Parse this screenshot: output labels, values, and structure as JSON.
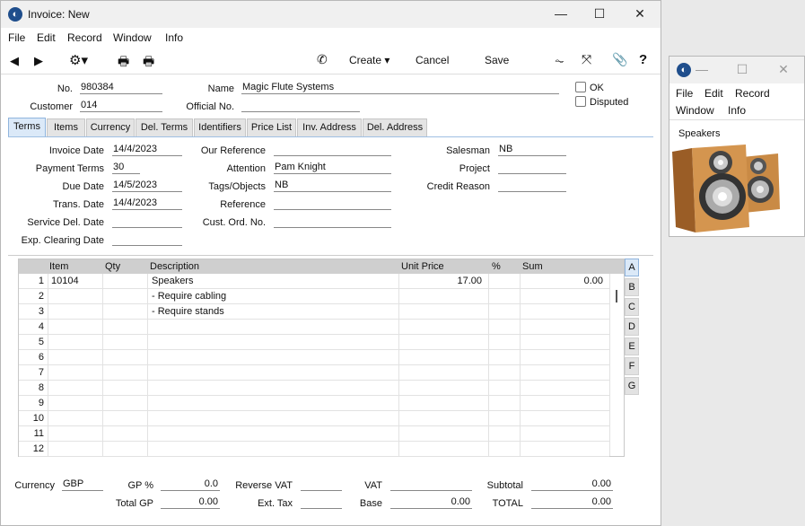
{
  "window": {
    "title": "Invoice: New"
  },
  "menu": [
    "File",
    "Edit",
    "Record",
    "Window",
    "Info"
  ],
  "toolbar": {
    "create": "Create",
    "cancel": "Cancel",
    "save": "Save",
    "help": "?"
  },
  "header": {
    "no_label": "No.",
    "no": "980384",
    "name_label": "Name",
    "name": "Magic Flute Systems",
    "customer_label": "Customer",
    "customer": "014",
    "official_label": "Official No.",
    "official": "",
    "ok_label": "OK",
    "disputed_label": "Disputed"
  },
  "tabs": [
    "Terms",
    "Items",
    "Currency",
    "Del. Terms",
    "Identifiers",
    "Price List",
    "Inv. Address",
    "Del. Address"
  ],
  "terms": {
    "invoice_date_label": "Invoice Date",
    "invoice_date": "14/4/2023",
    "payment_terms_label": "Payment Terms",
    "payment_terms": "30",
    "due_date_label": "Due Date",
    "due_date": "14/5/2023",
    "trans_date_label": "Trans. Date",
    "trans_date": "14/4/2023",
    "service_del_label": "Service Del. Date",
    "service_del": "",
    "exp_clearing_label": "Exp. Clearing Date",
    "exp_clearing": "",
    "our_ref_label": "Our Reference",
    "our_ref": "",
    "attention_label": "Attention",
    "attention": "Pam Knight",
    "tags_label": "Tags/Objects",
    "tags": "NB",
    "reference_label": "Reference",
    "reference": "",
    "cust_ord_label": "Cust. Ord. No.",
    "cust_ord": "",
    "salesman_label": "Salesman",
    "salesman": "NB",
    "project_label": "Project",
    "project": "",
    "credit_reason_label": "Credit Reason",
    "credit_reason": ""
  },
  "grid": {
    "columns": [
      "Item",
      "Qty",
      "Description",
      "Unit Price",
      "%",
      "Sum"
    ],
    "rows": [
      {
        "n": "1",
        "item": "10104",
        "qty": "",
        "desc": "Speakers",
        "price": "17.00",
        "pct": "",
        "sum": "0.00"
      },
      {
        "n": "2",
        "item": "",
        "qty": "",
        "desc": "- Require cabling",
        "price": "",
        "pct": "",
        "sum": ""
      },
      {
        "n": "3",
        "item": "",
        "qty": "",
        "desc": "- Require stands",
        "price": "",
        "pct": "",
        "sum": ""
      },
      {
        "n": "4",
        "item": "",
        "qty": "",
        "desc": "",
        "price": "",
        "pct": "",
        "sum": ""
      },
      {
        "n": "5",
        "item": "",
        "qty": "",
        "desc": "",
        "price": "",
        "pct": "",
        "sum": ""
      },
      {
        "n": "6",
        "item": "",
        "qty": "",
        "desc": "",
        "price": "",
        "pct": "",
        "sum": ""
      },
      {
        "n": "7",
        "item": "",
        "qty": "",
        "desc": "",
        "price": "",
        "pct": "",
        "sum": ""
      },
      {
        "n": "8",
        "item": "",
        "qty": "",
        "desc": "",
        "price": "",
        "pct": "",
        "sum": ""
      },
      {
        "n": "9",
        "item": "",
        "qty": "",
        "desc": "",
        "price": "",
        "pct": "",
        "sum": ""
      },
      {
        "n": "10",
        "item": "",
        "qty": "",
        "desc": "",
        "price": "",
        "pct": "",
        "sum": ""
      },
      {
        "n": "11",
        "item": "",
        "qty": "",
        "desc": "",
        "price": "",
        "pct": "",
        "sum": ""
      },
      {
        "n": "12",
        "item": "",
        "qty": "",
        "desc": "",
        "price": "",
        "pct": "",
        "sum": ""
      }
    ],
    "side": [
      "A",
      "B",
      "C",
      "D",
      "E",
      "F",
      "G"
    ]
  },
  "footer": {
    "currency_label": "Currency",
    "currency": "GBP",
    "gp_pct_label": "GP %",
    "gp_pct": "0.0",
    "total_gp_label": "Total GP",
    "total_gp": "0.00",
    "reverse_vat_label": "Reverse VAT",
    "reverse_vat": "",
    "ext_tax_label": "Ext. Tax",
    "ext_tax": "",
    "vat_label": "VAT",
    "vat": "",
    "base_label": "Base",
    "base": "0.00",
    "subtotal_label": "Subtotal",
    "subtotal": "0.00",
    "total_label": "TOTAL",
    "total": "0.00"
  },
  "picwin": {
    "menu": [
      "File",
      "Edit",
      "Record",
      "Window",
      "Info"
    ],
    "caption": "Speakers"
  },
  "icons": [
    "app-icon",
    "minimize-icon",
    "maximize-icon",
    "close-icon",
    "back-arrow-icon",
    "forward-arrow-icon",
    "gear-icon",
    "print-icon",
    "print-preview-icon",
    "phone-icon",
    "activity-icon",
    "expand-icon",
    "attachment-icon",
    "help-icon"
  ]
}
